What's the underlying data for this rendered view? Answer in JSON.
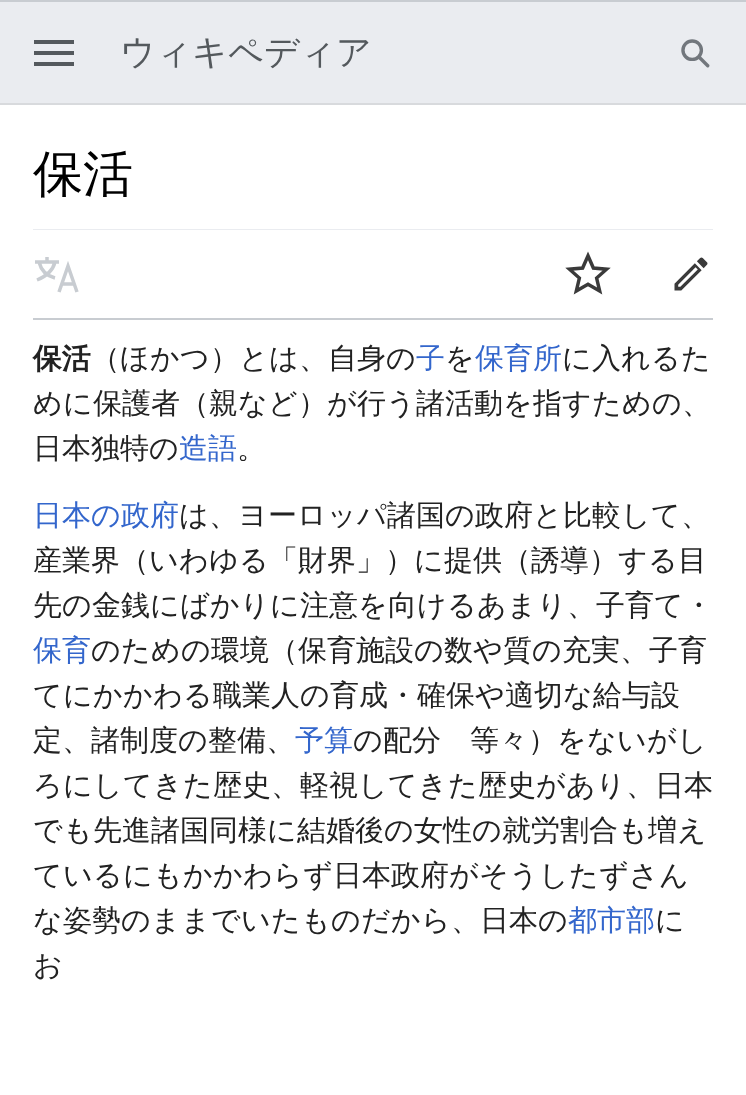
{
  "header": {
    "title": "ウィキペディア"
  },
  "article": {
    "title": "保活",
    "paragraphs": [
      [
        {
          "kind": "bold",
          "text": "保活"
        },
        {
          "kind": "plain",
          "text": "（ほかつ）とは、自身の"
        },
        {
          "kind": "link",
          "text": "子"
        },
        {
          "kind": "plain",
          "text": "を"
        },
        {
          "kind": "link",
          "text": "保育所"
        },
        {
          "kind": "plain",
          "text": "に入れるために保護者（親など）が行う諸活動を指すための、日本独特の"
        },
        {
          "kind": "link",
          "text": "造語"
        },
        {
          "kind": "plain",
          "text": "。"
        }
      ],
      [
        {
          "kind": "link",
          "text": "日本の政府"
        },
        {
          "kind": "plain",
          "text": "は、ヨーロッパ諸国の政府と比較して、産業界（いわゆる「財界」）に提供（誘導）する目先の金銭にばかりに注意を向けるあまり、子育て・"
        },
        {
          "kind": "link",
          "text": "保育"
        },
        {
          "kind": "plain",
          "text": "のための環境（保育施設の数や質の充実、子育てにかかわる職業人の育成・確保や適切な給与設定、諸制度の整備、"
        },
        {
          "kind": "link",
          "text": "予"
        },
        {
          "kind": "link",
          "text": "算"
        },
        {
          "kind": "plain",
          "text": "の配分　等々）をないがしろにしてきた歴史、軽視してきた歴史があり、日本でも先進諸国同様に結婚後の女性の就労割合も増えているにもかかわらず日本政府がそうしたずさんな姿勢のままでいたものだから、日本の"
        },
        {
          "kind": "link",
          "text": "都市部"
        },
        {
          "kind": "plain",
          "text": "にお"
        }
      ]
    ]
  }
}
